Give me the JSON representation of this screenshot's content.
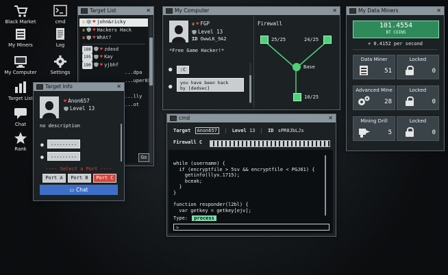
{
  "desktop": {
    "icons": [
      {
        "label": "Black Market",
        "icon": "cart-icon"
      },
      {
        "label": "cmd",
        "icon": "terminal-icon"
      },
      {
        "label": "My Miners",
        "icon": "miners-icon"
      },
      {
        "label": "Log",
        "icon": "log-icon"
      },
      {
        "label": "My Computer",
        "icon": "computer-icon"
      },
      {
        "label": "Settings",
        "icon": "gear-icon"
      },
      {
        "label": "Target List",
        "icon": "target-list-icon"
      },
      {
        "label": "Chat",
        "icon": "chat-icon"
      },
      {
        "label": "Rank",
        "icon": "star-icon"
      }
    ]
  },
  "target_list": {
    "title": "Target List",
    "rows": [
      {
        "prefix": "",
        "name": "john&ricky"
      },
      {
        "prefix": "",
        "name": "Hackers Hack"
      },
      {
        "prefix": "",
        "name": "WhAt?"
      },
      {
        "prefix": "188",
        "name": "zdasd"
      },
      {
        "prefix": "195",
        "name": "Kay"
      },
      {
        "prefix": "190",
        "name": "yjbhf"
      },
      {
        "prefix": "",
        "name": "...dpa"
      },
      {
        "prefix": "",
        "name": "...uper03"
      },
      {
        "prefix": "",
        "name": "...lly"
      },
      {
        "prefix": "",
        "name": "...ot"
      }
    ],
    "go_label": "Go"
  },
  "target_info": {
    "title": "Target Info",
    "name": "Anon657",
    "level": "Level 13",
    "description": "no description",
    "field1": ".........",
    "field2": ".........",
    "select_port_label": "---- Select a Port ----",
    "ports": [
      "Port A",
      "Port B",
      "Port C"
    ],
    "chat_button": "Chat"
  },
  "my_computer": {
    "title": "My Computer",
    "name": "FGP",
    "level": "Level 13",
    "id_label": "ID",
    "id_value": "OwwLK_9A2",
    "motto": "*Free Game Hacker!*",
    "msg1": ":C",
    "msg2": "you have been hack\nby [dedsec]",
    "firewall_label": "Firewall",
    "node_a": "25/25",
    "node_b": "24/25",
    "node_c": "10/25",
    "base_label": "Base"
  },
  "miners": {
    "title": "My Data Miners",
    "balance": "101.4554",
    "currency": "BT COINS",
    "rate": "+ 0.4152 per second",
    "cards": [
      {
        "name": "Data Miner",
        "count": "51",
        "lock_label": "Locked",
        "lock_count": "0"
      },
      {
        "name": "Advanced Mine",
        "count": "28",
        "lock_label": "Locked",
        "lock_count": "0"
      },
      {
        "name": "Mining Drill",
        "count": "5",
        "lock_label": "Locked",
        "lock_count": "0"
      }
    ]
  },
  "cmd": {
    "title": "cmd",
    "target_label": "Target",
    "target_value": "Anon657",
    "level_label": "Level",
    "level_value": "13",
    "id_label": "ID",
    "id_value": "sPR0JbLJs",
    "firewall_label": "Firewall C",
    "code": "while (username) {\n  if (encryptfile > 5sv && encryptfile < PGJ61) {\n    getinfo(llyx.1715);\n    bceak;\n  }\n}\n\nfunction responder(l2bl) {\n  var getkey = getkey[ejv];",
    "type_label": "Type:",
    "type_word": "process",
    "prompt": ">"
  },
  "colors": {
    "title_bar": "#8a969c",
    "accent_green": "#7fe0b0",
    "node_green": "#4fd17a",
    "port_c_red": "#d9463b",
    "chat_blue": "#3d6fc6",
    "select_port_red": "#d9463b"
  }
}
